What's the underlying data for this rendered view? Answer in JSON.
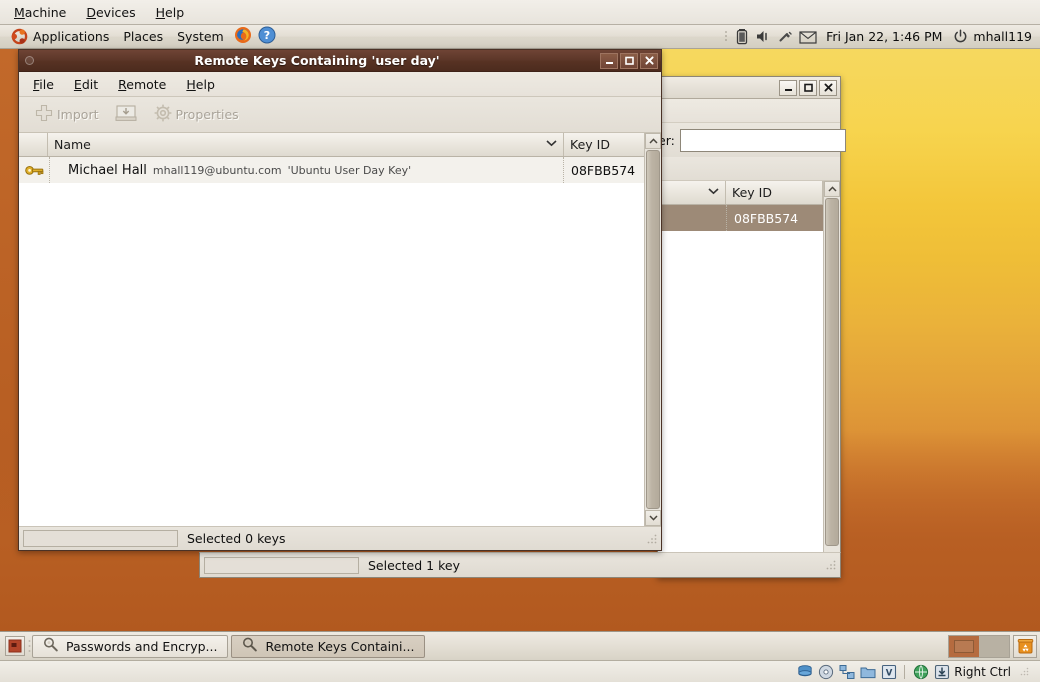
{
  "vbox": {
    "menus": [
      {
        "label": "Machine",
        "mnemonic": "M"
      },
      {
        "label": "Devices",
        "mnemonic": "D"
      },
      {
        "label": "Help",
        "mnemonic": "H"
      }
    ],
    "status": {
      "icons": [
        "harddisk-icon",
        "cd-icon",
        "network-icon",
        "shared-folder-icon",
        "virtualization-icon",
        "remote-display-icon",
        "mouse-capture-icon"
      ],
      "host_key": "Right Ctrl"
    }
  },
  "gnome_panel": {
    "logo": "ubuntu-logo-icon",
    "menus": [
      {
        "label": "Applications"
      },
      {
        "label": "Places"
      },
      {
        "label": "System"
      }
    ],
    "launchers": [
      "firefox-icon",
      "help-icon"
    ],
    "tray_icons": [
      "battery-icon",
      "volume-icon",
      "network-disconnected-icon",
      "mail-icon"
    ],
    "clock": "Fri Jan 22,  1:46 PM",
    "power_icon": "power-icon",
    "username": "mhall119"
  },
  "front_window": {
    "title": "Remote Keys Containing 'user day'",
    "window_buttons": [
      "minimize",
      "maximize",
      "close"
    ],
    "menus": [
      {
        "label": "File",
        "mnemonic": "F"
      },
      {
        "label": "Edit",
        "mnemonic": "E"
      },
      {
        "label": "Remote",
        "mnemonic": "R"
      },
      {
        "label": "Help",
        "mnemonic": "H"
      }
    ],
    "toolbar": [
      {
        "label": "Import",
        "icon": "plus-icon",
        "disabled": true
      },
      {
        "label": "",
        "icon": "export-icon",
        "disabled": true
      },
      {
        "label": "Properties",
        "icon": "gear-icon",
        "disabled": true
      }
    ],
    "columns": [
      {
        "label": "Name",
        "sort_indicator": "chevron-down-icon"
      },
      {
        "label": "Key ID"
      }
    ],
    "rows": [
      {
        "icon": "key-icon",
        "name": "Michael Hall",
        "email": "mhall119@ubuntu.com",
        "comment": "'Ubuntu User Day Key'",
        "key_id": "08FBB574"
      }
    ],
    "status": "Selected 0 keys"
  },
  "back_window": {
    "window_buttons": [
      "minimize",
      "maximize",
      "close"
    ],
    "filter_label": "er:",
    "filter_value": "",
    "filter_placeholder": "",
    "columns": [
      {
        "label": "Key ID",
        "sort_indicator": "chevron-down-icon"
      }
    ],
    "rows": [
      {
        "key_id": "08FBB574",
        "selected": true
      }
    ],
    "status": "Selected 1 key"
  },
  "taskbar": {
    "show_desktop_icon": "show-desktop-icon",
    "tasks": [
      {
        "label": "Passwords and Encryp...",
        "icon": "key-search-icon",
        "active": false
      },
      {
        "label": "Remote Keys Containi...",
        "icon": "key-search-icon",
        "active": true
      }
    ],
    "workspaces": [
      {
        "index": 1,
        "active": true
      },
      {
        "index": 2,
        "active": false
      }
    ],
    "trash_icon": "trash-icon"
  },
  "colors": {
    "titlebar_active": "#5d3729",
    "desktop_top": "#f6d85f",
    "desktop_bottom": "#b85f23",
    "selection_inactive": "#9d8a77",
    "key_icon": "#d9a81c"
  }
}
